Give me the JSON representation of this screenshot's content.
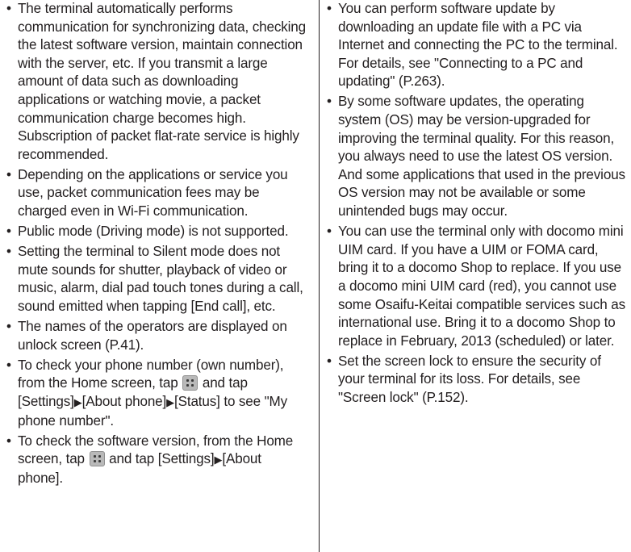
{
  "left_column": {
    "b1": "The terminal automatically performs communication for synchronizing data, checking the latest software version, maintain connection with the server, etc. If you transmit a large amount of data such as downloading applications or watching movie, a packet communication charge becomes high. Subscription of packet flat-rate service is highly recommended.",
    "b2": "Depending on the applications or service you use, packet communication fees may be charged even in Wi-Fi communication.",
    "b3": "Public mode (Driving mode) is not supported.",
    "b4": "Setting the terminal to Silent mode does not mute sounds for shutter, playback of video or music, alarm, dial pad touch tones during a call, sound emitted when tapping [End call], etc.",
    "b5": "The names of the operators are displayed on unlock screen (P.41).",
    "b6": {
      "pre": "To check your phone number (own number), from the Home screen, tap",
      "mid": "and tap [Settings]",
      "p2": "[About phone]",
      "post": "[Status] to see \"My phone number\"."
    },
    "b7": {
      "pre": "To check the software version, from the Home screen, tap",
      "mid": "and tap [Settings]",
      "post": "[About phone]."
    }
  },
  "right_column": {
    "b1": "You can perform software update by downloading an update file with a PC via Internet and connecting the PC to the terminal. For details, see \"Connecting to a PC and updating\" (P.263).",
    "b2": "By some software updates, the operating system (OS) may be version-upgraded for improving the terminal quality. For this reason, you always need to use the latest OS version. And some applications that used in the previous OS version may not be available or some unintended bugs may occur.",
    "b3": "You can use the terminal only with docomo mini UIM card. If you have a UIM or FOMA card, bring it to a docomo Shop to replace. If you use a docomo mini UIM card (red), you cannot use some Osaifu-Keitai compatible services such as international use. Bring it to a docomo Shop to replace in February, 2013 (scheduled) or later.",
    "b4": "Set the screen lock to ensure the security of your terminal for its loss. For details, see \"Screen lock\" (P.152)."
  },
  "glyphs": {
    "arrow": "▶"
  },
  "icons": {
    "menu": "apps-menu-icon"
  }
}
